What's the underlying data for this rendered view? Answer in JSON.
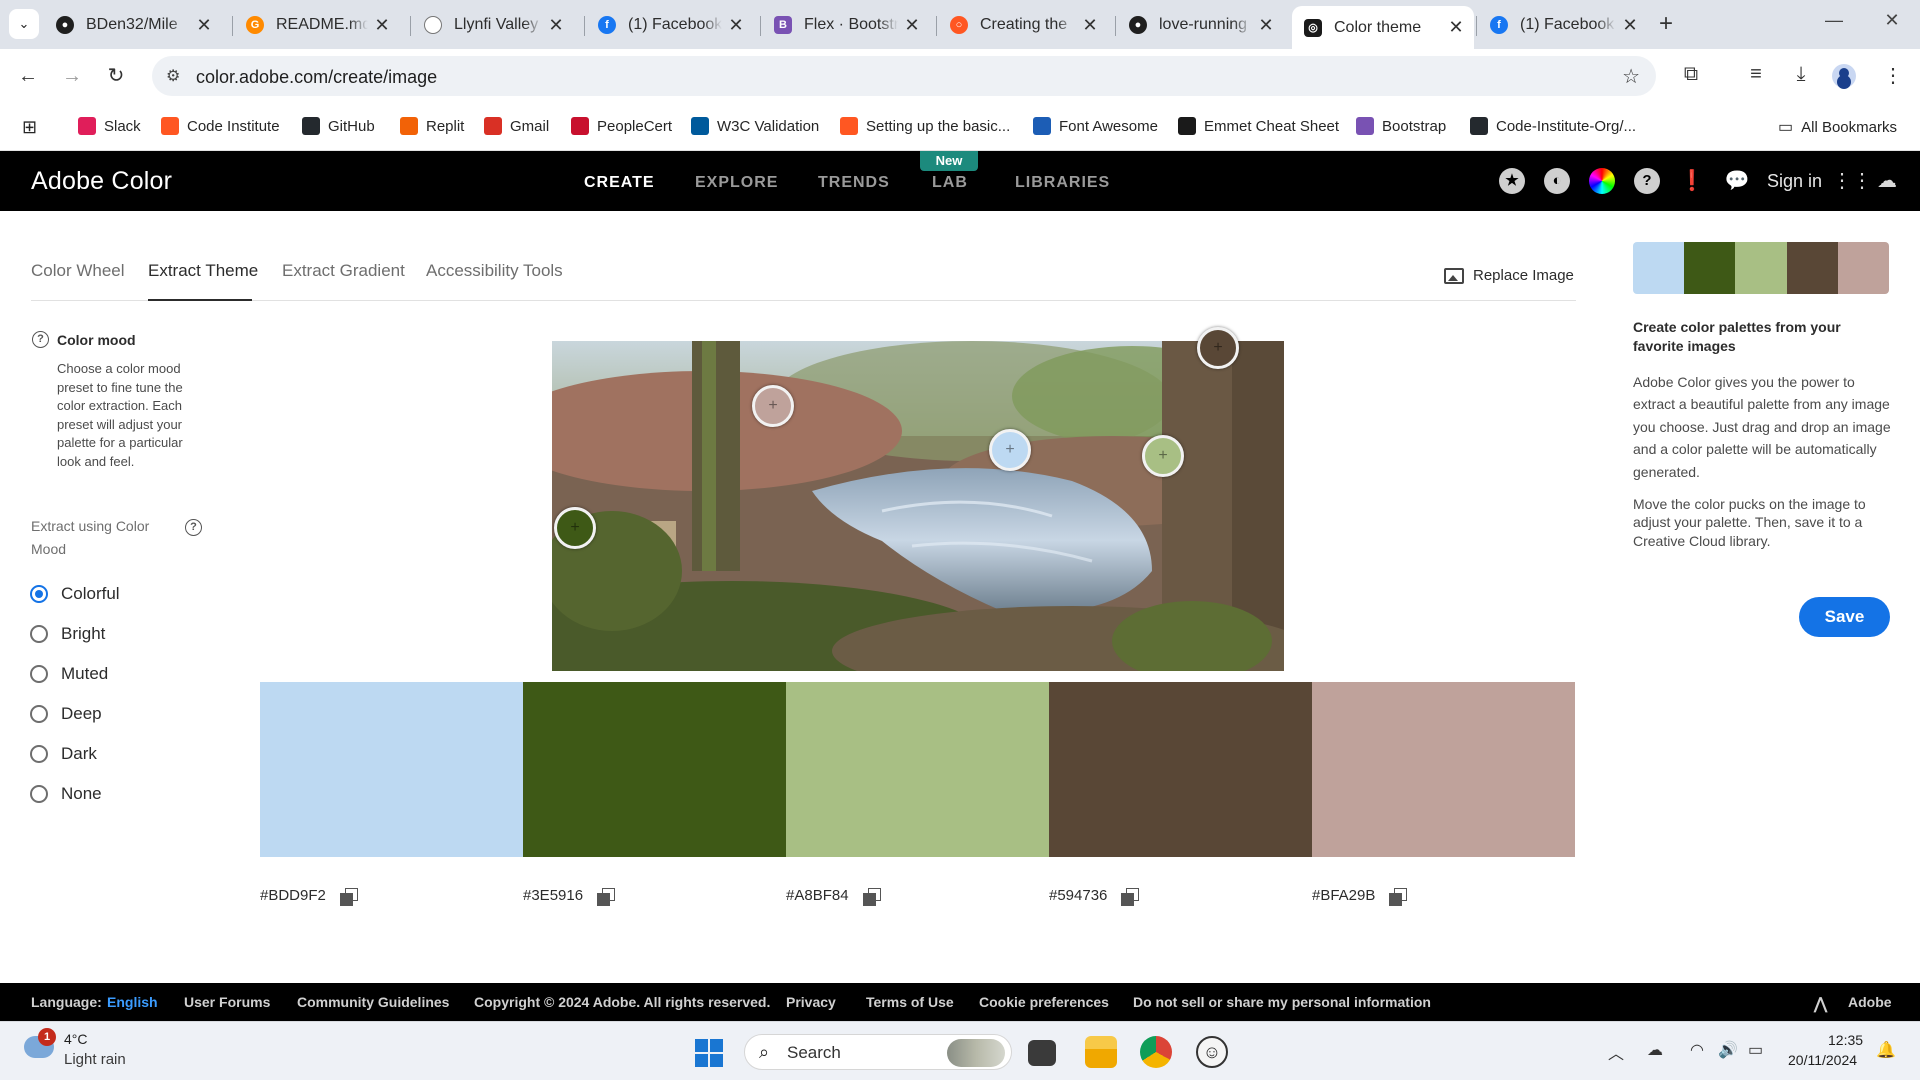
{
  "browser": {
    "tabs": [
      {
        "title": "BDen32/Mile",
        "icon": "github-icon",
        "active": false
      },
      {
        "title": "README.md",
        "icon": "gitpod-icon",
        "active": false
      },
      {
        "title": "Llynfi Valley A",
        "icon": "generic-page-icon",
        "active": false
      },
      {
        "title": "(1) Facebook",
        "icon": "facebook-icon",
        "active": false
      },
      {
        "title": "Flex · Bootstr",
        "icon": "bootstrap-icon",
        "active": false
      },
      {
        "title": "Creating the",
        "icon": "codeinstitute-icon",
        "active": false
      },
      {
        "title": "love-running",
        "icon": "github-icon",
        "active": false
      },
      {
        "title": "Color theme",
        "icon": "adobe-color-icon",
        "active": true
      },
      {
        "title": "(1) Facebook",
        "icon": "facebook-icon",
        "active": false
      }
    ],
    "url": "color.adobe.com/create/image",
    "bookmarks": [
      {
        "label": "Slack",
        "icon": "slack-icon",
        "color": "#e01e5a"
      },
      {
        "label": "Code Institute",
        "icon": "codeinstitute-icon",
        "color": "#ff5722"
      },
      {
        "label": "GitHub",
        "icon": "github-icon",
        "color": "#24292e"
      },
      {
        "label": "Replit",
        "icon": "replit-icon",
        "color": "#f26207"
      },
      {
        "label": "Gmail",
        "icon": "gmail-icon",
        "color": "#d93025"
      },
      {
        "label": "PeopleCert",
        "icon": "peoplecert-icon",
        "color": "#c8102e"
      },
      {
        "label": "W3C Validation",
        "icon": "w3c-icon",
        "color": "#005a9c"
      },
      {
        "label": "Setting up the basic...",
        "icon": "codeinstitute-icon",
        "color": "#ff5722"
      },
      {
        "label": "Font Awesome",
        "icon": "font-awesome-icon",
        "color": "#1c5db5"
      },
      {
        "label": "Emmet Cheat Sheet",
        "icon": "emmet-icon",
        "color": "#1a1a1a"
      },
      {
        "label": "Bootstrap",
        "icon": "bootstrap-icon",
        "color": "#7952b3"
      },
      {
        "label": "Code-Institute-Org/...",
        "icon": "github-icon",
        "color": "#24292e"
      }
    ],
    "all_bookmarks": "All Bookmarks"
  },
  "header": {
    "brand": "Adobe Color",
    "nav": [
      {
        "label": "CREATE",
        "active": true
      },
      {
        "label": "EXPLORE",
        "active": false
      },
      {
        "label": "TRENDS",
        "active": false
      },
      {
        "label": "LAB",
        "active": false
      },
      {
        "label": "LIBRARIES",
        "active": false
      }
    ],
    "new_badge": "New",
    "sign_in": "Sign in"
  },
  "subtabs": [
    {
      "label": "Color Wheel",
      "active": false
    },
    {
      "label": "Extract Theme",
      "active": true
    },
    {
      "label": "Extract Gradient",
      "active": false
    },
    {
      "label": "Accessibility Tools",
      "active": false
    }
  ],
  "replace_image": "Replace Image",
  "color_mood": {
    "title": "Color mood",
    "description": "Choose a color mood preset to fine tune the color extraction. Each preset will adjust your palette for a particular look and feel.",
    "extract_label": "Extract using Color Mood",
    "options": [
      {
        "label": "Colorful",
        "selected": true
      },
      {
        "label": "Bright",
        "selected": false
      },
      {
        "label": "Muted",
        "selected": false
      },
      {
        "label": "Deep",
        "selected": false
      },
      {
        "label": "Dark",
        "selected": false
      },
      {
        "label": "None",
        "selected": false
      }
    ]
  },
  "palette": [
    {
      "hex": "#BDD9F2",
      "color": "#BDD9F2"
    },
    {
      "hex": "#3E5916",
      "color": "#3E5916"
    },
    {
      "hex": "#A8BF84",
      "color": "#A8BF84"
    },
    {
      "hex": "#594736",
      "color": "#594736"
    },
    {
      "hex": "#BFA29B",
      "color": "#BFA29B"
    }
  ],
  "right_panel": {
    "title": "Create color palettes from your favorite images",
    "paragraph1": "Adobe Color gives you the power to extract a beautiful palette from any image you choose. Just drag and drop an image and a color palette will be automatically generated.",
    "paragraph2": "Move the color pucks on the image to adjust your palette. Then, save it to a Creative Cloud library.",
    "save": "Save"
  },
  "footer": {
    "language_label": "Language:",
    "language_value": "English",
    "links": [
      "User Forums",
      "Community Guidelines",
      "Copyright © 2024 Adobe. All rights reserved.",
      "Privacy",
      "Terms of Use",
      "Cookie preferences",
      "Do not sell or share my personal information"
    ],
    "adobe": "Adobe"
  },
  "taskbar": {
    "temp": "4°C",
    "weather": "Light rain",
    "weather_badge": "1",
    "search": "Search",
    "time": "12:35",
    "date": "20/11/2024"
  }
}
